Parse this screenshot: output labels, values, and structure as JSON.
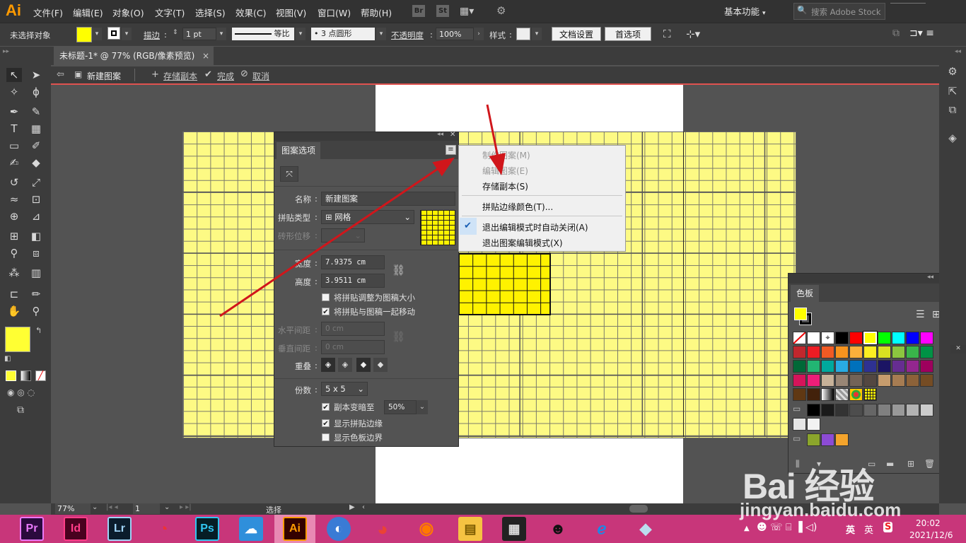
{
  "app": {
    "logo": "Ai",
    "menus": [
      "文件(F)",
      "编辑(E)",
      "对象(O)",
      "文字(T)",
      "选择(S)",
      "效果(C)",
      "视图(V)",
      "窗口(W)",
      "帮助(H)"
    ],
    "bridge_icons": [
      "Br",
      "St"
    ],
    "workspace": "基本功能",
    "search_placeholder": "搜索 Adobe Stock"
  },
  "control_bar": {
    "selection_status": "未选择对象",
    "stroke_label": "描边",
    "stroke_weight": "1 pt",
    "stroke_profile": "等比",
    "brush": "3 点圆形",
    "opacity_label": "不透明度",
    "opacity_value": "100%",
    "style_label": "样式",
    "doc_setup_button": "文档设置",
    "preferences_button": "首选项"
  },
  "document_tab": {
    "title": "未标题-1* @ 77% (RGB/像素预览)",
    "close": "×"
  },
  "pattern_bar": {
    "name": "新建图案",
    "save_copy": "存储副本",
    "done": "完成",
    "cancel": "取消"
  },
  "pattern_panel": {
    "title": "图案选项",
    "name_label": "名称",
    "name_value": "新建图案",
    "tile_type_label": "拼贴类型",
    "tile_type_value": "网格",
    "brick_offset_label": "砖形位移",
    "width_label": "宽度",
    "width_value": "7.9375 cm",
    "height_label": "高度",
    "height_value": "3.9511 cm",
    "size_tile_to_art": "将拼贴调整为图稿大小",
    "size_tile_to_art_checked": false,
    "move_tile_with_art": "将拼贴与图稿一起移动",
    "move_tile_with_art_checked": true,
    "h_spacing_label": "水平间距",
    "h_spacing_value": "0 cm",
    "v_spacing_label": "垂直间距",
    "v_spacing_value": "0 cm",
    "overlap_label": "重叠",
    "copies_label": "份数",
    "copies_value": "5 x 5",
    "dim_copies": "副本变暗至",
    "dim_copies_checked": true,
    "dim_value": "50%",
    "show_tile_edge": "显示拼贴边缘",
    "show_tile_edge_checked": true,
    "show_swatch_bounds": "显示色板边界",
    "show_swatch_bounds_checked": false
  },
  "context_menu": {
    "items": [
      {
        "label": "制作图案(M)",
        "disabled": true,
        "checked": false
      },
      {
        "label": "编辑图案(E)",
        "disabled": true,
        "checked": false
      },
      {
        "label": "存储副本(S)",
        "disabled": false,
        "checked": false
      },
      {
        "label": "拼贴边缘颜色(T)...",
        "disabled": false,
        "checked": false
      },
      {
        "label": "退出编辑模式时自动关闭(A)",
        "disabled": false,
        "checked": true
      },
      {
        "label": "退出图案编辑模式(X)",
        "disabled": false,
        "checked": false
      }
    ]
  },
  "swatches_panel": {
    "title": "色板",
    "colors": [
      [
        "none",
        "#ffffff",
        "#ffffff",
        "#000000",
        "#ff0000",
        "#ffff00",
        "#00ff00",
        "#00ffff",
        "#0000ff",
        "#ff00ff"
      ],
      [
        "#c1272d",
        "#ed1c24",
        "#f15a24",
        "#f7931e",
        "#fbb03b",
        "#fcee21",
        "#d9e021",
        "#8cc63f",
        "#39b54a",
        "#009245"
      ],
      [
        "#006837",
        "#22b573",
        "#00a99d",
        "#29abe2",
        "#0071bc",
        "#2e3192",
        "#1b1464",
        "#662d91",
        "#93278f",
        "#9e005d"
      ],
      [
        "#d4145a",
        "#ed1e79",
        "#c7b299",
        "#998675",
        "#736357",
        "#534741",
        "#c69c6d",
        "#a67c52",
        "#8c6239",
        "#754c24"
      ],
      [
        "#603813",
        "#42210b",
        "gradient1",
        "gradient2",
        "pattern1",
        "pattern2"
      ],
      [
        "folder",
        "#000000",
        "#1a1a1a",
        "#333333",
        "#4d4d4d",
        "#666666",
        "#808080",
        "#999999",
        "#b3b3b3",
        "#cccccc"
      ],
      [
        "#e6e6e6",
        "#f2f2f2"
      ],
      [
        "folder",
        "#8ba52b",
        "#8c4bd5",
        "#f4a42c"
      ]
    ]
  },
  "status_bar": {
    "zoom": "77%",
    "page": "1",
    "tool": "选择"
  },
  "taskbar": {
    "apps": [
      "Pr",
      "Id",
      "Lr",
      "",
      "Ps",
      "",
      "Ai",
      "",
      "",
      "",
      "",
      "",
      "",
      "",
      ""
    ],
    "tray_lang": "英",
    "time": "20:02",
    "date": "2021/12/6"
  },
  "watermark": {
    "logo": "Bai 经验",
    "url": "jingyan.baidu.com"
  }
}
